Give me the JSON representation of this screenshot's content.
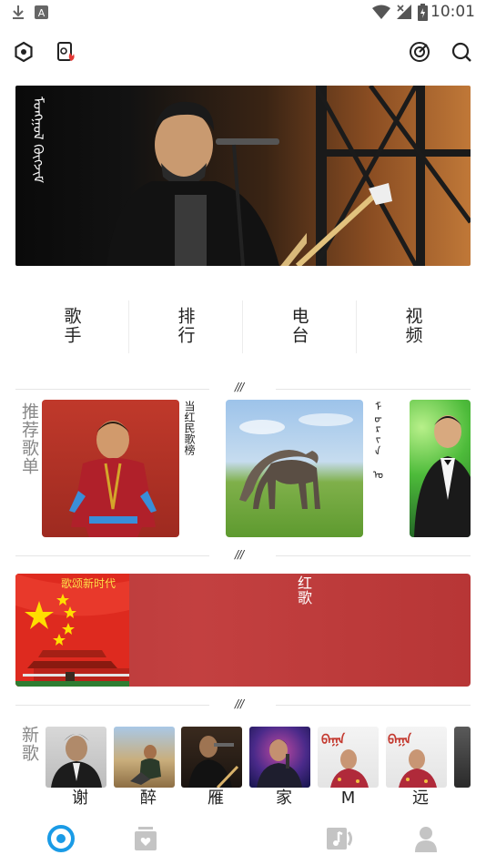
{
  "status_bar": {
    "time": "10:01"
  },
  "toolbar": {
    "left_icons": [
      "hexagon-settings-icon",
      "phone-hot-icon"
    ],
    "right_icons": [
      "music-disc-icon",
      "search-icon"
    ]
  },
  "banner": {
    "text": "ᠮᠣᠩᠭᠣᠯ ᠬᠦᠭᠵᠢᠮ",
    "accent": "#c07838"
  },
  "categories": [
    {
      "label": "歌手"
    },
    {
      "label": "排行"
    },
    {
      "label": "电台"
    },
    {
      "label": "视频"
    }
  ],
  "section_mark": "///",
  "recommend": {
    "side_label": "推荐歌单",
    "cards": [
      {
        "title": "当红民歌榜"
      },
      {
        "title": "ᠮᠣᠷᠢᠨ ᠤ"
      }
    ]
  },
  "red_banner": {
    "flag_caption": "歌颂新时代",
    "title": "红歌",
    "color": "#c03c3c"
  },
  "new_songs": {
    "side_label": "新歌",
    "items": [
      {
        "title": "谢"
      },
      {
        "title": "醉"
      },
      {
        "title": "雁"
      },
      {
        "title": "家"
      },
      {
        "title": "My"
      },
      {
        "title": "远"
      }
    ],
    "cover_text": "ᠪᠠᠭᠠ"
  },
  "bottom_nav": {
    "items": [
      "home-disc-icon",
      "favorite-box-icon",
      "music-note-icon",
      "profile-icon"
    ],
    "active_color": "#1a9be6"
  }
}
